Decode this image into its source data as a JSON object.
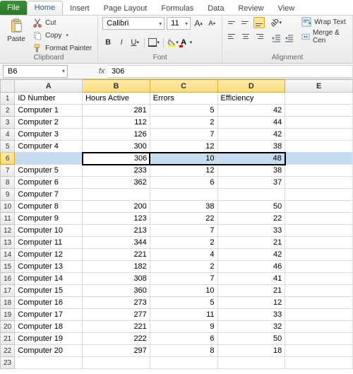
{
  "tabs": {
    "file": "File",
    "home": "Home",
    "insert": "Insert",
    "page_layout": "Page Layout",
    "formulas": "Formulas",
    "data": "Data",
    "review": "Review",
    "view": "View"
  },
  "ribbon": {
    "clipboard": {
      "paste": "Paste",
      "cut": "Cut",
      "copy": "Copy",
      "format_painter": "Format Painter",
      "label": "Clipboard"
    },
    "font": {
      "name": "Calibri",
      "size": "11",
      "label": "Font"
    },
    "alignment": {
      "wrap": "Wrap Text",
      "merge": "Merge & Cen",
      "label": "Alignment"
    }
  },
  "formula_bar": {
    "name_box": "B6",
    "value": "306"
  },
  "columns": [
    "A",
    "B",
    "C",
    "D",
    "E"
  ],
  "headers": {
    "A": "ID Number",
    "B": "Hours Active",
    "C": "Errors",
    "D": "Efficiency"
  },
  "rows": [
    {
      "n": 1,
      "A": "ID Number",
      "B": "Hours Active",
      "C": "Errors",
      "D": "Efficiency",
      "header": true
    },
    {
      "n": 2,
      "A": "Computer 1",
      "B": 281,
      "C": 5,
      "D": 42
    },
    {
      "n": 3,
      "A": "Computer 2",
      "B": 112,
      "C": 2,
      "D": 44
    },
    {
      "n": 4,
      "A": "Computer 3",
      "B": 126,
      "C": 7,
      "D": 42
    },
    {
      "n": 5,
      "A": "Computer 4",
      "B": 300,
      "C": 12,
      "D": 38
    },
    {
      "n": 6,
      "A": "",
      "B": 306,
      "C": 10,
      "D": 48,
      "selected": true
    },
    {
      "n": 7,
      "A": "Computer 5",
      "B": 233,
      "C": 12,
      "D": 38
    },
    {
      "n": 8,
      "A": "Computer 6",
      "B": 362,
      "C": 6,
      "D": 37
    },
    {
      "n": 9,
      "A": "Computer 7",
      "B": "",
      "C": "",
      "D": ""
    },
    {
      "n": 10,
      "A": "Computer 8",
      "B": 200,
      "C": 38,
      "D": 50
    },
    {
      "n": 11,
      "A": "Computer 9",
      "B": 123,
      "C": 22,
      "D": 22
    },
    {
      "n": 12,
      "A": "Computer 10",
      "B": 213,
      "C": 7,
      "D": 33
    },
    {
      "n": 13,
      "A": "Computer 11",
      "B": 344,
      "C": 2,
      "D": 21
    },
    {
      "n": 14,
      "A": "Computer 12",
      "B": 221,
      "C": 4,
      "D": 42
    },
    {
      "n": 15,
      "A": "Computer 13",
      "B": 182,
      "C": 2,
      "D": 46
    },
    {
      "n": 16,
      "A": "Computer 14",
      "B": 308,
      "C": 7,
      "D": 41
    },
    {
      "n": 17,
      "A": "Computer 15",
      "B": 360,
      "C": 10,
      "D": 21
    },
    {
      "n": 18,
      "A": "Computer 16",
      "B": 273,
      "C": 5,
      "D": 12
    },
    {
      "n": 19,
      "A": "Computer 17",
      "B": 277,
      "C": 11,
      "D": 33
    },
    {
      "n": 20,
      "A": "Computer 18",
      "B": 221,
      "C": 9,
      "D": 32
    },
    {
      "n": 21,
      "A": "Computer 19",
      "B": 222,
      "C": 6,
      "D": 50
    },
    {
      "n": 22,
      "A": "Computer 20",
      "B": 297,
      "C": 8,
      "D": 18
    },
    {
      "n": 23,
      "A": "",
      "B": "",
      "C": "",
      "D": ""
    }
  ],
  "selection": {
    "active": "B6",
    "range_cols": [
      "B",
      "C",
      "D"
    ]
  },
  "colors": {
    "accent_yellow": "#fde699",
    "accent_border": "#d4a926",
    "file_tab": "#2d7a2d",
    "sel_row": "#c6dcf0"
  }
}
